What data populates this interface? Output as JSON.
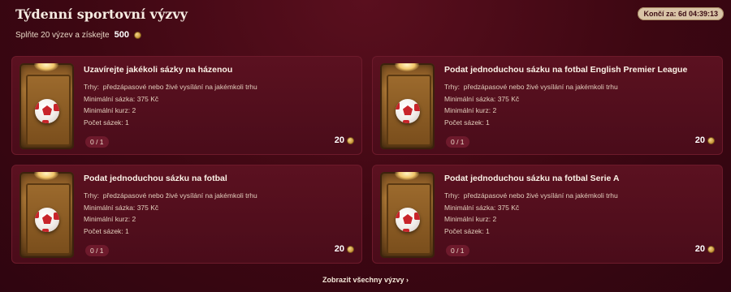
{
  "header": {
    "title": "Týdenní sportovní výzvy",
    "subtitle": "Splňte 20 výzev a získejte",
    "reward": "500",
    "timer": "Končí za: 6d 04:39:13"
  },
  "labels": {
    "markets": "Trhy:",
    "min_stake": "Minimální sázka:",
    "min_odds": "Minimální kurz:",
    "bet_count": "Počet sázek:"
  },
  "cards": [
    {
      "title": "Uzavírejte jakékoli sázky na házenou",
      "markets": "předzápasové nebo živé vysílání na jakémkoli trhu",
      "min_stake": "375 Kč",
      "min_odds": "2",
      "bet_count": "1",
      "progress": "0 / 1",
      "points": "20"
    },
    {
      "title": "Podat jednoduchou sázku na fotbal English Premier League",
      "markets": "předzápasové nebo živé vysílání na jakémkoli trhu",
      "min_stake": "375 Kč",
      "min_odds": "2",
      "bet_count": "1",
      "progress": "0 / 1",
      "points": "20"
    },
    {
      "title": "Podat jednoduchou sázku na fotbal",
      "markets": "předzápasové nebo živé vysílání na jakémkoli trhu",
      "min_stake": "375 Kč",
      "min_odds": "2",
      "bet_count": "1",
      "progress": "0 / 1",
      "points": "20"
    },
    {
      "title": "Podat jednoduchou sázku na fotbal Serie A",
      "markets": "předzápasové nebo živé vysílání na jakémkoli trhu",
      "min_stake": "375 Kč",
      "min_odds": "2",
      "bet_count": "1",
      "progress": "0 / 1",
      "points": "20"
    }
  ],
  "footer": {
    "show_all": "Zobrazit všechny výzvy ›"
  },
  "icons": {
    "coin": "coin-icon",
    "card_image": "soccer-ball-icon"
  }
}
